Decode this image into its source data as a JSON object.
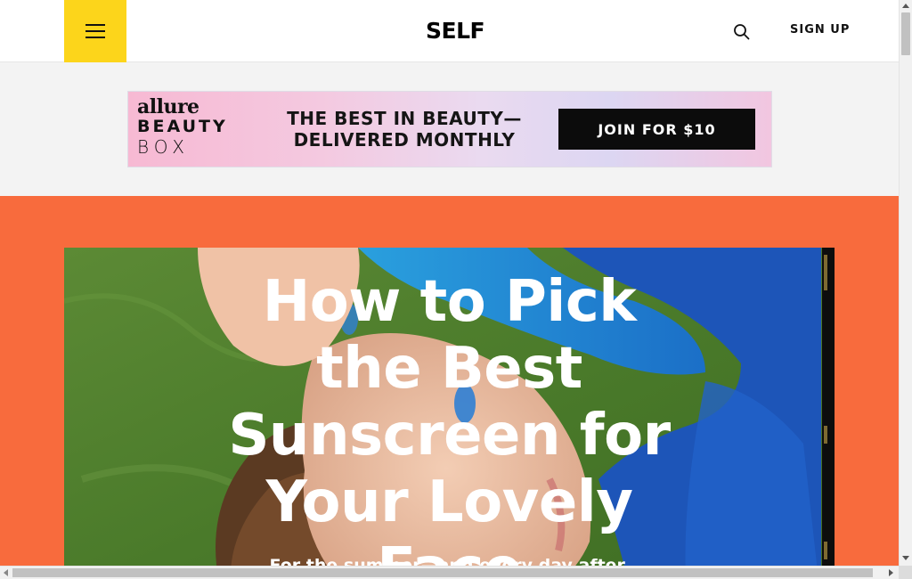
{
  "header": {
    "menu_icon": "hamburger-menu-icon",
    "logo": "SELF",
    "search_icon": "search-icon",
    "signup_label": "SIGN UP",
    "accent_color": "#fcd51b"
  },
  "ad": {
    "brand_line1": "allure",
    "brand_line2": "BEAUTY",
    "brand_line3": "BOX",
    "headline_line1": "THE BEST IN BEAUTY—",
    "headline_line2": "DELIVERED MONTHLY",
    "cta_label": "JOIN FOR $10"
  },
  "hero": {
    "background_color": "#f86b3d",
    "title": "How to Pick the Best Sunscreen for Your Lovely Face",
    "subtitle": "For the summer—and every day after."
  }
}
